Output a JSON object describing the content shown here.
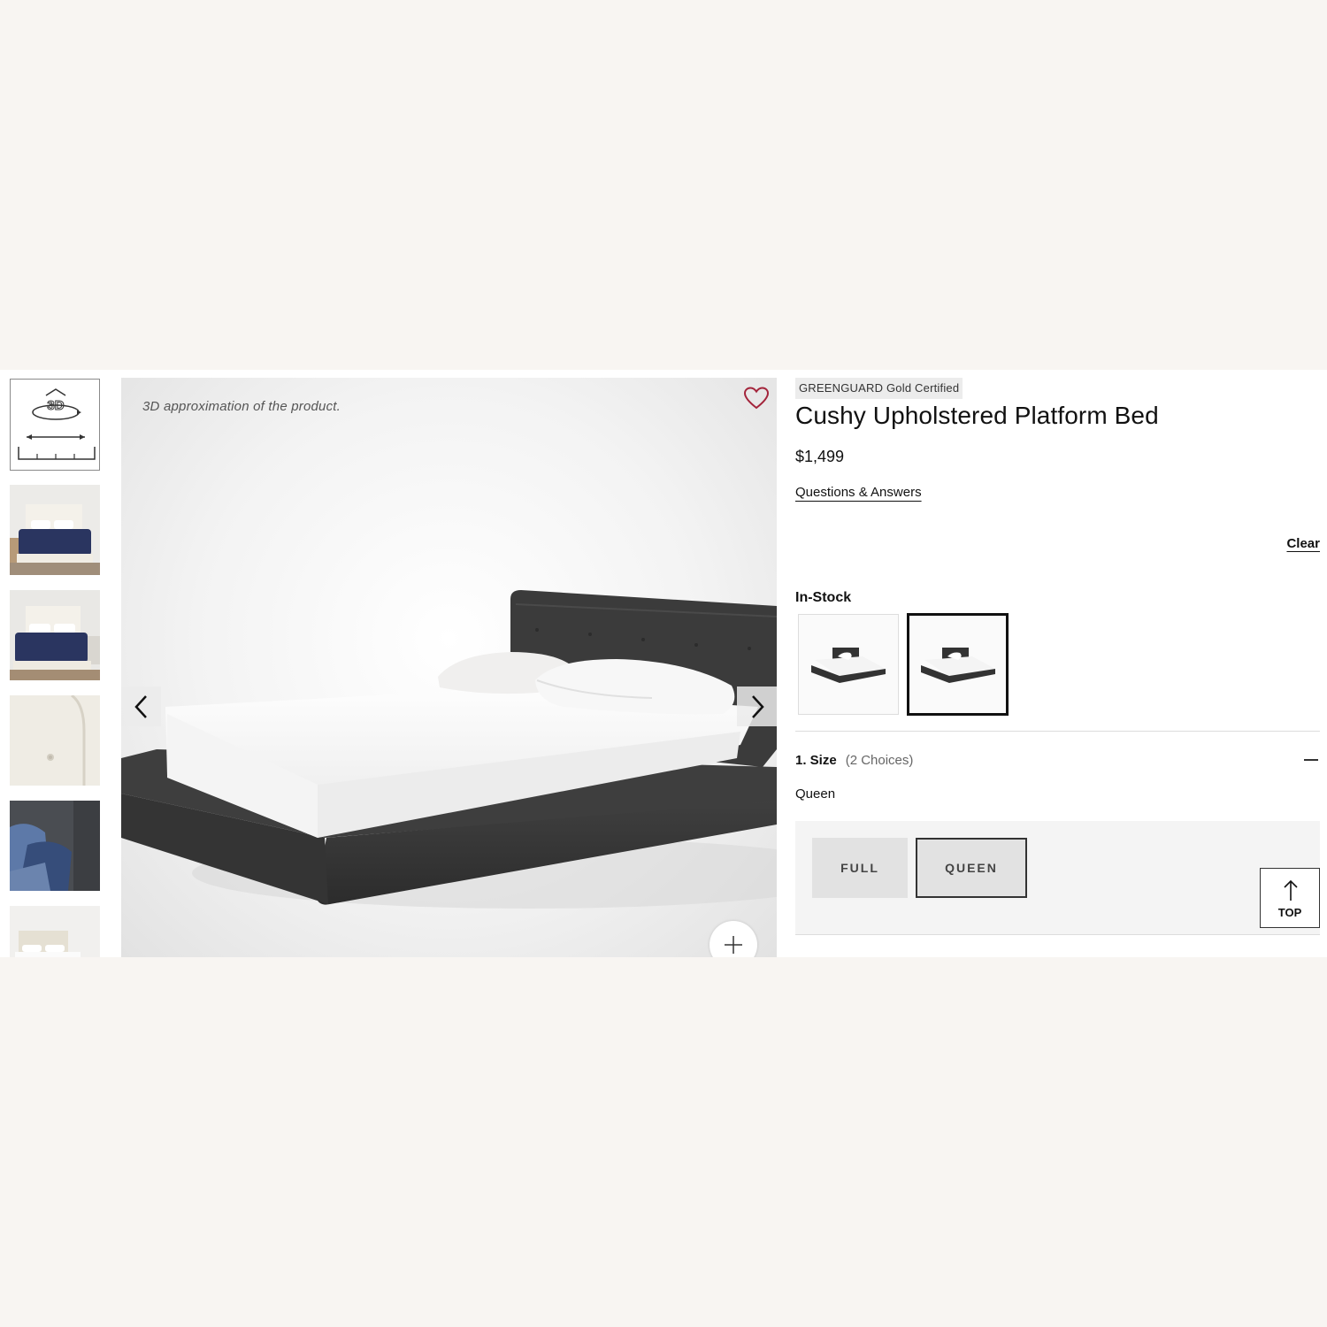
{
  "viewer": {
    "caption": "3D approximation of the product."
  },
  "thumbnails": [
    {
      "name": "3d-view"
    },
    {
      "name": "bedroom-navy-bedding"
    },
    {
      "name": "bedroom-navy-bedding-alt"
    },
    {
      "name": "headboard-tufting-detail"
    },
    {
      "name": "gray-corner-detail"
    },
    {
      "name": "ivory-bed"
    }
  ],
  "product": {
    "badge": "GREENGUARD Gold Certified",
    "title": "Cushy Upholstered Platform Bed",
    "price": "$1,499",
    "qa_link": "Questions & Answers",
    "clear_label": "Clear",
    "stock_label": "In-Stock"
  },
  "size": {
    "step": "1. Size",
    "choices": "(2 Choices)",
    "selected": "Queen",
    "options": [
      "FULL",
      "QUEEN"
    ]
  },
  "top_button": {
    "label": "TOP"
  },
  "colors": {
    "accent_heart": "#a3243b",
    "frame_charcoal": "#3a3a3a",
    "navy_bedding": "#2a3560"
  }
}
